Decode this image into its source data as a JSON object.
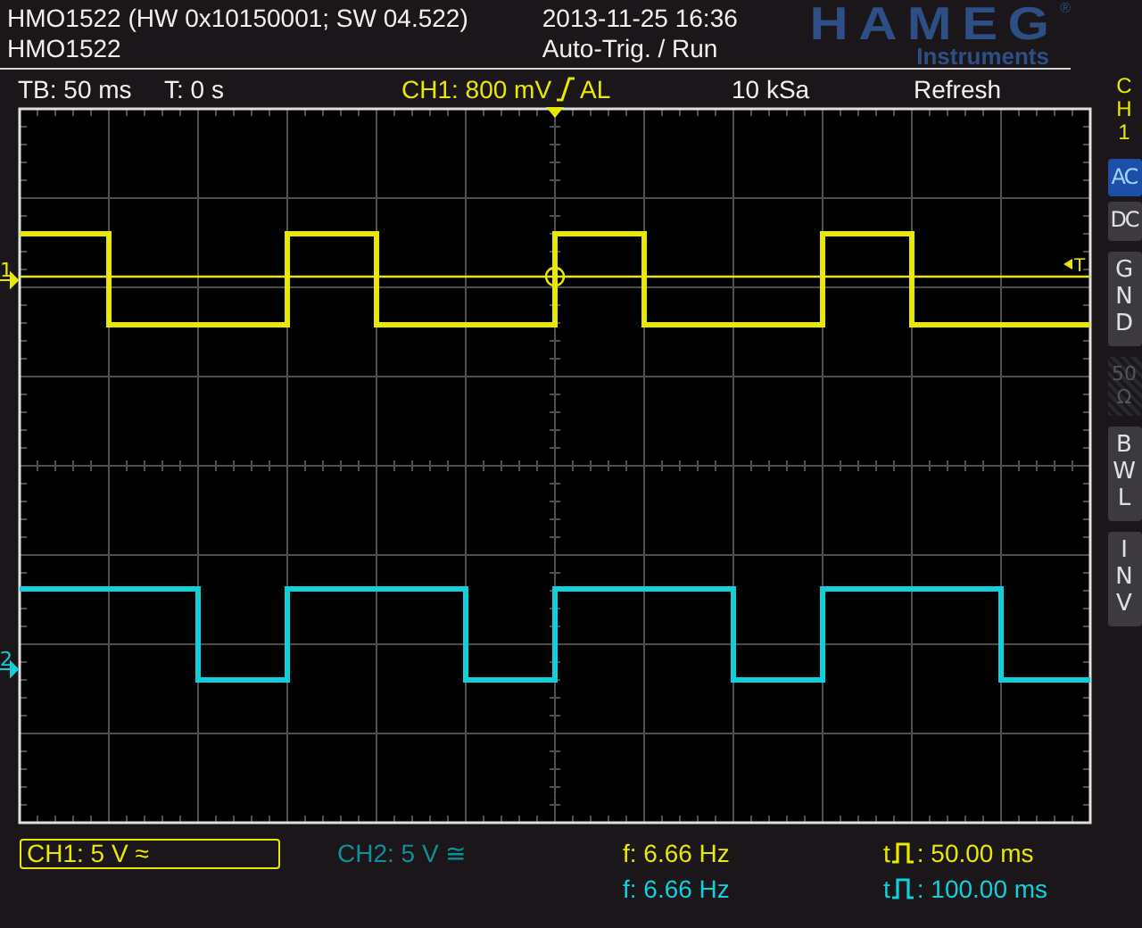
{
  "header": {
    "model_line": "HMO1522 (HW 0x10150001; SW 04.522)",
    "name": "HMO1522",
    "datetime": "2013-11-25 16:36",
    "status": "Auto-Trig. / Run",
    "logo": "HAMEG",
    "logo_mark": "®",
    "logo_sub": "Instruments"
  },
  "info_bar": {
    "timebase": "TB: 50 ms",
    "trigger_time": "T: 0 s",
    "trigger_source": "CH1: 800 mV",
    "trigger_mode": "AL",
    "sample_rate": "10 kSa",
    "acquisition": "Refresh"
  },
  "screen": {
    "trigger_marker": "T",
    "channels": [
      {
        "label": "1",
        "color": "#e8e800"
      },
      {
        "label": "2",
        "color": "#10d0dc"
      }
    ]
  },
  "side_panel": {
    "title": "CH1",
    "buttons": [
      {
        "label": "AC",
        "kind": "horizontal",
        "selected": true,
        "disabled": false
      },
      {
        "label": "DC",
        "kind": "horizontal",
        "selected": false,
        "disabled": false
      },
      {
        "label": "GND",
        "kind": "vertical",
        "selected": false,
        "disabled": false
      },
      {
        "label": "50 Ω",
        "kind": "stacked",
        "selected": false,
        "disabled": true
      },
      {
        "label": "BWL",
        "kind": "vertical",
        "selected": false,
        "disabled": false
      },
      {
        "label": "INV",
        "kind": "vertical",
        "selected": false,
        "disabled": false
      }
    ]
  },
  "channel_status": [
    {
      "label": "CH1: 5 V ≈",
      "selected": true
    },
    {
      "label": "CH2: 5 V ≅",
      "selected": false
    }
  ],
  "measurements": [
    {
      "frequency": "f: 6.66 Hz",
      "pulse_prefix": "t",
      "pulse_width": ": 50.00 ms"
    },
    {
      "frequency": "f: 6.66 Hz",
      "pulse_prefix": "t",
      "pulse_width": ": 100.00 ms"
    }
  ]
}
